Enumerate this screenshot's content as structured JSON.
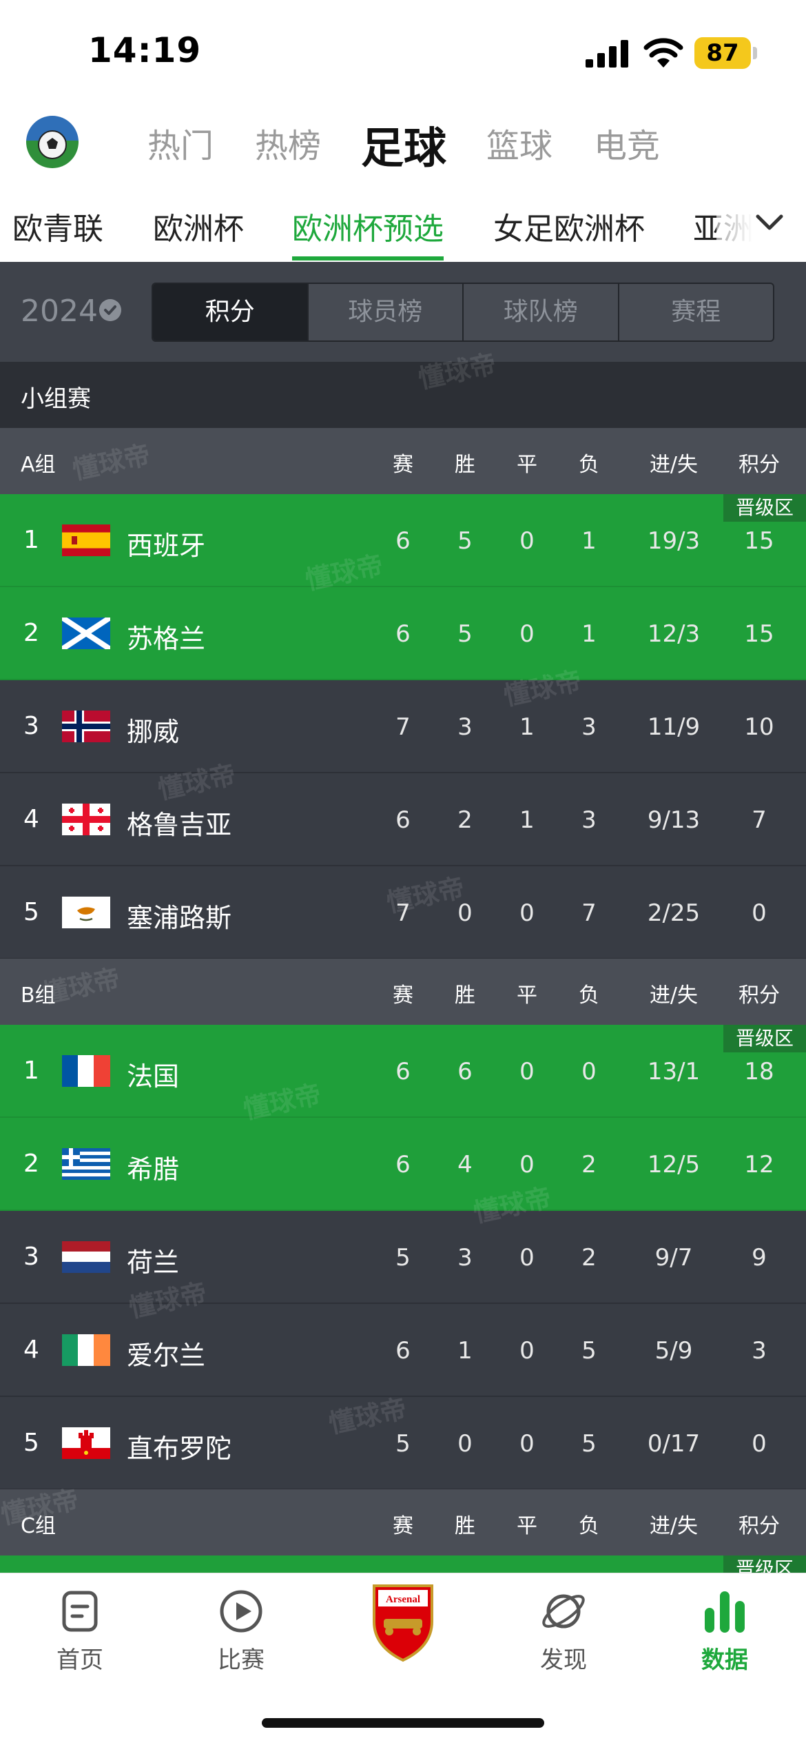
{
  "status_bar": {
    "time": "14:19",
    "battery": "87"
  },
  "top_nav": {
    "tabs": [
      "热门",
      "热榜",
      "足球",
      "篮球",
      "电竞"
    ],
    "active": "足球"
  },
  "sub_nav": {
    "tabs": [
      "欧青联",
      "欧洲杯",
      "欧洲杯预选",
      "女足欧洲杯",
      "亚洲"
    ],
    "active": "欧洲杯预选"
  },
  "filter": {
    "season": "2024",
    "segments": [
      "积分",
      "球员榜",
      "球队榜",
      "赛程"
    ],
    "active": "积分"
  },
  "stage": "小组赛",
  "columns": [
    "赛",
    "胜",
    "平",
    "负",
    "进/失",
    "积分"
  ],
  "qualify_label": "晋级区",
  "watermark": "懂球帝",
  "groups": [
    {
      "name": "A组",
      "rows": [
        {
          "rank": "1",
          "team": "西班牙",
          "p": "6",
          "w": "5",
          "d": "0",
          "l": "1",
          "gf_ga": "19/3",
          "pts": "15",
          "qualified": true
        },
        {
          "rank": "2",
          "team": "苏格兰",
          "p": "6",
          "w": "5",
          "d": "0",
          "l": "1",
          "gf_ga": "12/3",
          "pts": "15",
          "qualified": true
        },
        {
          "rank": "3",
          "team": "挪威",
          "p": "7",
          "w": "3",
          "d": "1",
          "l": "3",
          "gf_ga": "11/9",
          "pts": "10",
          "qualified": false
        },
        {
          "rank": "4",
          "team": "格鲁吉亚",
          "p": "6",
          "w": "2",
          "d": "1",
          "l": "3",
          "gf_ga": "9/13",
          "pts": "7",
          "qualified": false
        },
        {
          "rank": "5",
          "team": "塞浦路斯",
          "p": "7",
          "w": "0",
          "d": "0",
          "l": "7",
          "gf_ga": "2/25",
          "pts": "0",
          "qualified": false
        }
      ]
    },
    {
      "name": "B组",
      "rows": [
        {
          "rank": "1",
          "team": "法国",
          "p": "6",
          "w": "6",
          "d": "0",
          "l": "0",
          "gf_ga": "13/1",
          "pts": "18",
          "qualified": true
        },
        {
          "rank": "2",
          "team": "希腊",
          "p": "6",
          "w": "4",
          "d": "0",
          "l": "2",
          "gf_ga": "12/5",
          "pts": "12",
          "qualified": true
        },
        {
          "rank": "3",
          "team": "荷兰",
          "p": "5",
          "w": "3",
          "d": "0",
          "l": "2",
          "gf_ga": "9/7",
          "pts": "9",
          "qualified": false
        },
        {
          "rank": "4",
          "team": "爱尔兰",
          "p": "6",
          "w": "1",
          "d": "0",
          "l": "5",
          "gf_ga": "5/9",
          "pts": "3",
          "qualified": false
        },
        {
          "rank": "5",
          "team": "直布罗陀",
          "p": "5",
          "w": "0",
          "d": "0",
          "l": "5",
          "gf_ga": "0/17",
          "pts": "0",
          "qualified": false
        }
      ]
    },
    {
      "name": "C组",
      "rows": []
    }
  ],
  "tab_bar": {
    "items": [
      {
        "label": "首页",
        "icon": "home-doc-icon"
      },
      {
        "label": "比赛",
        "icon": "play-icon"
      },
      {
        "label": "",
        "icon": "arsenal-crest"
      },
      {
        "label": "发现",
        "icon": "planet-icon"
      },
      {
        "label": "数据",
        "icon": "bar-chart-icon"
      }
    ],
    "active": "数据"
  },
  "colors": {
    "accent_green": "#1ea83c",
    "qualify_green": "#1f9f3a",
    "dark_bg": "#383c44"
  }
}
